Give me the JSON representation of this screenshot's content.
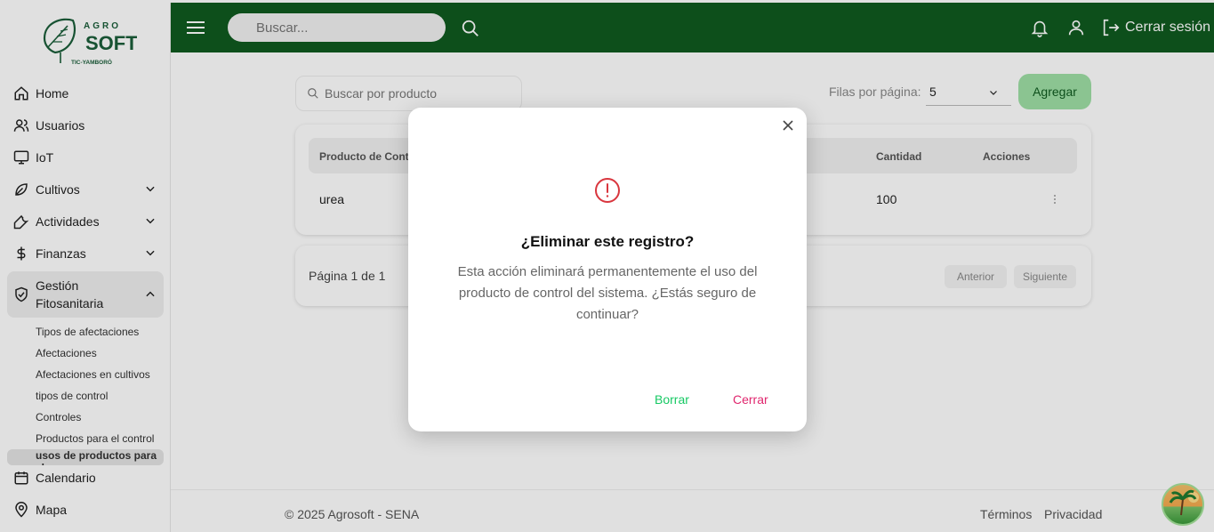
{
  "brand": {
    "name_top": "AGRO",
    "name_main": "SOFT",
    "name_sub": "TIC-YAMBORÓ"
  },
  "sidebar": {
    "items": [
      {
        "label": "Home",
        "icon": "home-icon"
      },
      {
        "label": "Usuarios",
        "icon": "users-icon"
      },
      {
        "label": "IoT",
        "icon": "monitor-icon"
      },
      {
        "label": "Cultivos",
        "icon": "leaf-icon"
      },
      {
        "label": "Actividades",
        "icon": "wrench-icon"
      },
      {
        "label": "Finanzas",
        "icon": "dollar-icon"
      }
    ],
    "active_group": {
      "label_line1": "Gestión",
      "label_line2": "Fitosanitaria",
      "icon": "shield-icon",
      "sub_items": [
        "Tipos de afectaciones",
        "Afectaciones",
        "Afectaciones en cultivos",
        "tipos de control",
        "Controles",
        "Productos para el control",
        "usos de productos para el"
      ]
    },
    "bottom_items": [
      {
        "label": "Calendario",
        "icon": "calendar-icon"
      },
      {
        "label": "Mapa",
        "icon": "map-pin-icon"
      }
    ]
  },
  "topbar": {
    "search_placeholder": "Buscar...",
    "logout_label": "Cerrar sesión"
  },
  "main": {
    "search_placeholder": "Buscar por producto",
    "rows_label": "Filas por página:",
    "rows_value": "5",
    "add_label": "Agregar",
    "table": {
      "headers": [
        "Producto de Contr",
        "Cantidad",
        "Acciones"
      ],
      "rows": [
        {
          "producto": "urea",
          "cantidad": "100"
        }
      ]
    },
    "pagination": {
      "label": "Página 1 de 1",
      "prev": "Anterior",
      "next": "Siguiente"
    }
  },
  "footer": {
    "copyright": "© 2025 Agrosoft - SENA",
    "terms": "Términos",
    "privacy": "Privacidad"
  },
  "modal": {
    "title": "¿Eliminar este registro?",
    "body": "Esta acción eliminará permanentemente el uso del producto de control del sistema. ¿Estás seguro de continuar?",
    "confirm": "Borrar",
    "cancel": "Cerrar"
  },
  "colors": {
    "topbar": "#0f5a1f",
    "accent_green": "#17c964",
    "danger": "#e0266e",
    "warning_icon": "#d9363e"
  }
}
